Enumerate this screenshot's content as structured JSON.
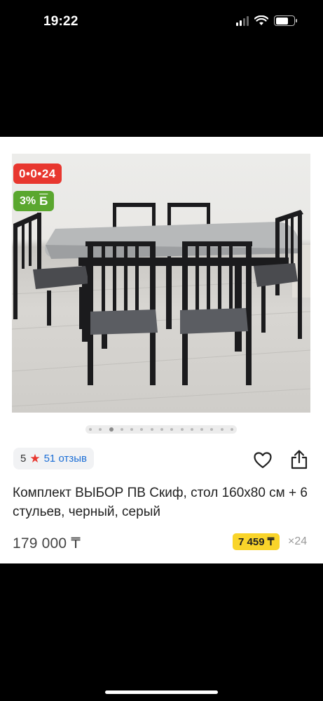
{
  "status_bar": {
    "time": "19:22"
  },
  "product": {
    "badges": {
      "timer": "0•0•24",
      "bonus_percent": "3%",
      "bonus_symbol": "Б"
    },
    "gallery": {
      "total_images": 15,
      "active_index": 2
    },
    "rating": {
      "score": "5",
      "reviews": "51 отзыв"
    },
    "title": "Комплект ВЫБОР ПВ Скиф, стол 160х80 см + 6 стульев, черный, серый",
    "price": "179 000 ₸",
    "installment": {
      "monthly": "7 459 ₸",
      "multiplier": "×24"
    }
  },
  "icons": [
    "signal-icon",
    "wifi-icon",
    "battery-icon",
    "star-icon",
    "heart-icon",
    "share-icon"
  ],
  "colors": {
    "timer_badge": "#e8372f",
    "bonus_badge": "#5aa72f",
    "installment_badge": "#f9d42a",
    "link": "#1d6fd6"
  }
}
